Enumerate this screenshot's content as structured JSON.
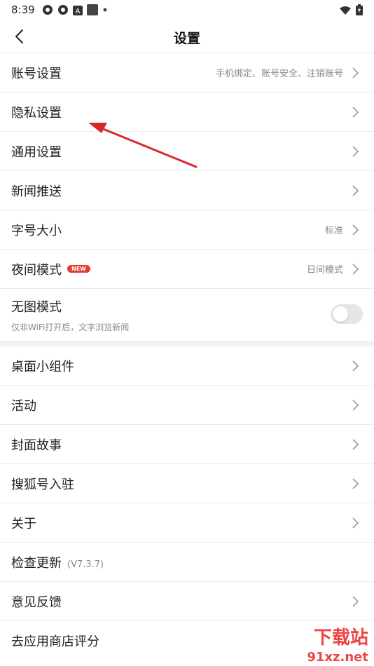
{
  "status_bar": {
    "time": "8:39",
    "icons": [
      "app-icon-1",
      "app-icon-2",
      "a-icon",
      "square-icon",
      "dot-icon"
    ],
    "right_icons": [
      "wifi-icon",
      "battery-icon"
    ]
  },
  "nav": {
    "title": "设置",
    "back_icon": "back-chevron-icon"
  },
  "items": [
    {
      "label": "账号设置",
      "hint": "手机绑定、账号安全、注销账号"
    },
    {
      "label": "隐私设置"
    },
    {
      "label": "通用设置"
    },
    {
      "label": "新闻推送"
    },
    {
      "label": "字号大小",
      "hint": "标准"
    },
    {
      "label": "夜间模式",
      "badge": "NEW",
      "hint": "日间模式"
    },
    {
      "label": "无图模式",
      "sub": "仅非WiFi打开后，文字浏览新闻",
      "toggle_on": false
    },
    {
      "label": "桌面小组件"
    },
    {
      "label": "活动"
    },
    {
      "label": "封面故事"
    },
    {
      "label": "搜狐号入驻"
    },
    {
      "label": "关于"
    },
    {
      "label": "检查更新",
      "version": "(V7.3.7)"
    },
    {
      "label": "意见反馈"
    },
    {
      "label": "去应用商店评分"
    }
  ],
  "watermark": {
    "line1": "下载站",
    "line2": "91xz.net"
  },
  "colors": {
    "badge": "#e43a2d",
    "annotation_arrow": "#d9282a"
  }
}
